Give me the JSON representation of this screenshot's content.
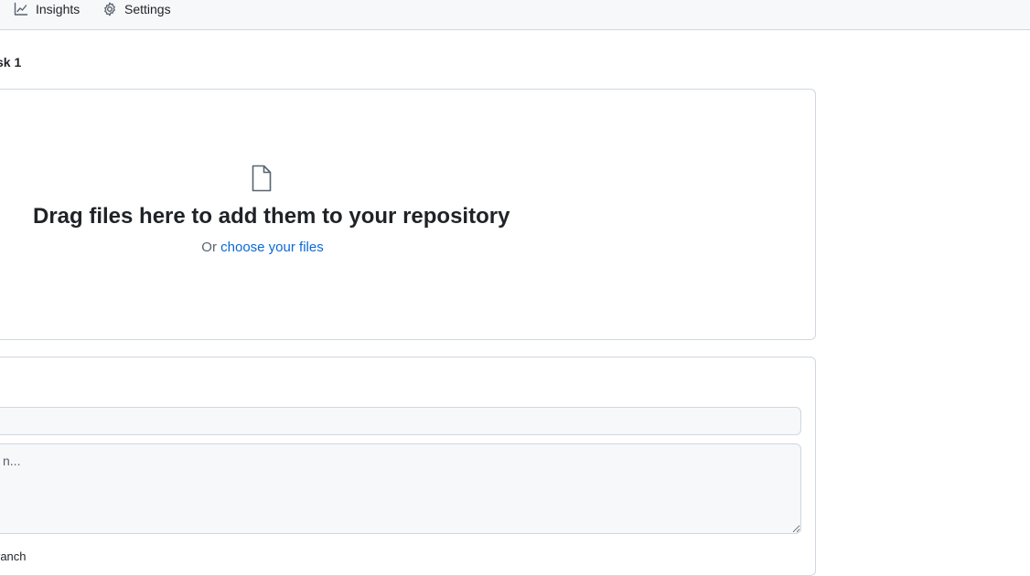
{
  "nav": {
    "insights_label": "Insights",
    "insights_icon": "graph-icon",
    "settings_label": "Settings",
    "settings_icon": "gear-icon"
  },
  "breadcrumb": {
    "current": "sk 1"
  },
  "dropzone": {
    "icon": "file-icon",
    "title": "Drag files here to add them to your repository",
    "or_text": "Or ",
    "link_text": "choose your files"
  },
  "commit": {
    "summary_value": "",
    "description_placeholder": "n...",
    "branch_text": "ranch"
  },
  "colors": {
    "link": "#0969da",
    "border": "#d0d7de",
    "input_bg": "#f6f8fa",
    "muted_text": "#59636e"
  }
}
